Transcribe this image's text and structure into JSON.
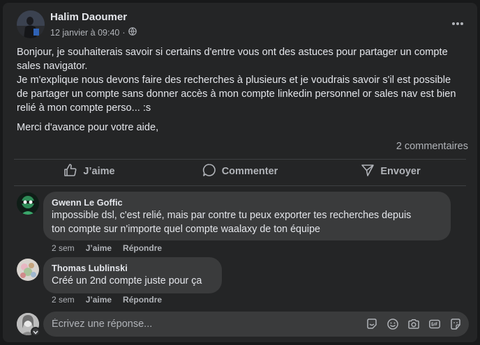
{
  "post": {
    "author": "Halim Daoumer",
    "date": "12 janvier à 09:40",
    "separator": "·",
    "paragraphs": [
      "Bonjour, je souhaiterais savoir si certains d'entre vous ont des astuces pour partager un compte sales navigator.",
      "Je m'explique nous devons faire des recherches à plusieurs et je voudrais savoir s'il est possible de partager un compte sans donner accès à mon compte linkedin personnel or sales nav est bien relié à mon compte perso... :s",
      "Merci d'avance pour votre aide,"
    ],
    "comment_count": "2 commentaires"
  },
  "actions": {
    "like": "J’aime",
    "comment": "Commenter",
    "share": "Envoyer"
  },
  "comments": [
    {
      "author": "Gwenn Le Goffic",
      "line1": "impossible dsl, c'est relié, mais par contre tu peux exporter tes recherches depuis",
      "line2": "ton compte sur n'importe quel compte waalaxy de ton équipe",
      "time": "2 sem",
      "like": "J’aime",
      "reply": "Répondre"
    },
    {
      "author": "Thomas Lublinski",
      "text": "Créé un 2nd compte juste pour ça",
      "time": "2 sem",
      "like": "J’aime",
      "reply": "Répondre"
    }
  ],
  "reply_box": {
    "placeholder": "Écrivez une réponse..."
  },
  "icons": {
    "privacy": "globe-icon",
    "more": "more-horizontal-icon",
    "like": "thumbs-up-icon",
    "comment": "speech-bubble-icon",
    "share": "send-icon",
    "reply_tools": [
      "sticker-icon",
      "emoji-icon",
      "camera-icon",
      "gif-icon",
      "avatar-sticker-icon"
    ]
  },
  "colors": {
    "background": "#18191a",
    "card": "#242526",
    "bubble": "#3a3b3c",
    "primary_text": "#e4e6eb",
    "secondary_text": "#b0b3b8"
  }
}
